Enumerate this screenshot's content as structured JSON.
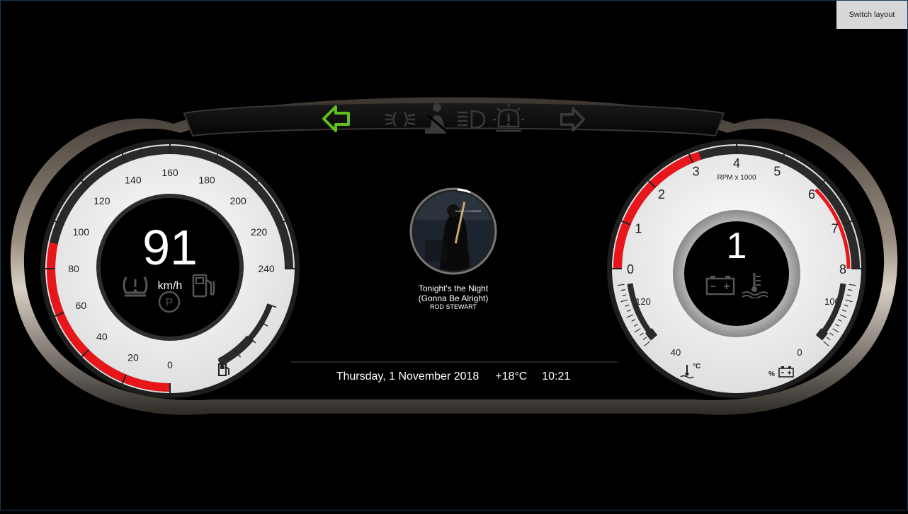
{
  "toolbar": {
    "switch_layout_label": "Switch layout"
  },
  "speedometer": {
    "speed": "91",
    "unit": "km/h",
    "ticks": [
      "0",
      "20",
      "40",
      "60",
      "80",
      "100",
      "120",
      "140",
      "160",
      "180",
      "200",
      "220",
      "240"
    ],
    "speed_value": 91,
    "max": 240,
    "fuel_level_fraction": 0.5
  },
  "tachometer": {
    "gear": "1",
    "unit": "RPM x 1000",
    "ticks": [
      "0",
      "1",
      "2",
      "3",
      "4",
      "5",
      "6",
      "7",
      "8"
    ],
    "rpm_value": 3.2,
    "redline_start": 6,
    "temp_ticks": [
      "40",
      "120"
    ],
    "battery_ticks": [
      "0",
      "100"
    ],
    "temp_unit": "°C",
    "battery_unit": "%",
    "temp_level_fraction": 0.15,
    "battery_level_fraction": 0.15
  },
  "media": {
    "title_line1": "Tonight's the Night",
    "title_line2": "(Gonna Be Alright)",
    "artist": "ROD STEWART",
    "album_art_text": "SARAH O'CONNOR"
  },
  "status_bar": {
    "date": "Thursday, 1 November 2018",
    "temperature": "+18°C",
    "time": "10:21"
  },
  "indicators": {
    "left_turn_active": true,
    "right_turn_active": false,
    "active_color": "#5fbf1f",
    "inactive_color": "#3a3a3a"
  },
  "colors": {
    "needle_red": "#e8161b",
    "dial_face": "#f1f1f1",
    "dark_ring": "#2a2a2a"
  }
}
